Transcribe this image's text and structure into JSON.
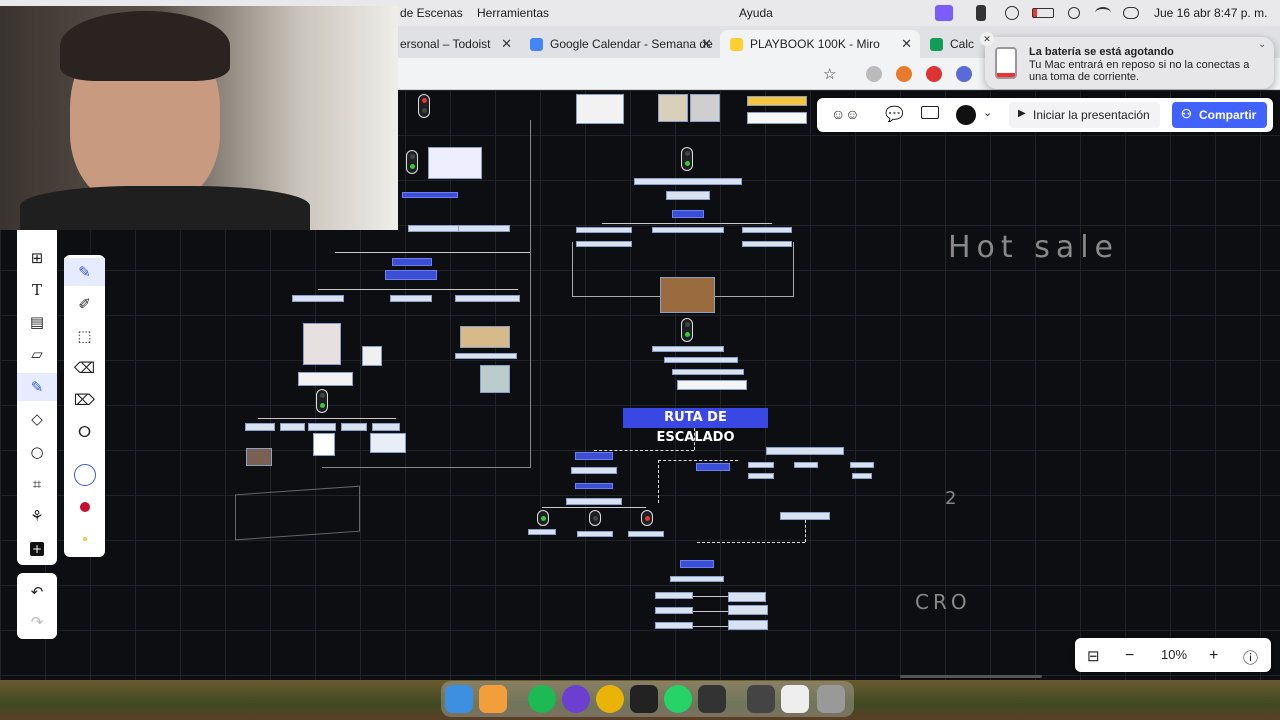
{
  "menubar": {
    "items": [
      "de Escenas",
      "Herramientas",
      "Ayuda"
    ],
    "datetime": "Jue 16 abr  8:47 p. m."
  },
  "tabs": [
    {
      "label": "ersonal – Todoist",
      "favicon_color": "#e44332"
    },
    {
      "label": "Google Calendar - Semana de",
      "favicon_color": "#4285f4"
    },
    {
      "label": "PLAYBOOK 100K - Miro",
      "favicon_color": "#ffd02f",
      "active": true
    },
    {
      "label": "Calc",
      "favicon_color": "#0f9d58"
    }
  ],
  "notification": {
    "title": "La batería se está agotando",
    "body": "Tu Mac entrará en reposo si no la conectas a una toma de corriente."
  },
  "miro_toolbar": {
    "present_label": "Iniciar la presentación",
    "share_label": "Compartir",
    "icons": [
      "reactions-icon",
      "comment-icon",
      "video-icon",
      "color-icon"
    ]
  },
  "board": {
    "banner": "RUTA DE ESCALADO",
    "handwriting": [
      "Hot sale",
      "2",
      "CRO"
    ]
  },
  "left_toolbar": {
    "tools": [
      "templates-icon",
      "text-icon",
      "frame-icon",
      "sticky-note-icon",
      "pen-icon",
      "shapes-icon",
      "comment-icon",
      "crop-icon",
      "more-tools-icon",
      "plus-icon"
    ],
    "undo": [
      "undo-icon",
      "redo-icon"
    ]
  },
  "pen_toolbar": {
    "tools": [
      "pen-icon",
      "highlighter-icon",
      "smart-draw-icon",
      "eraser-icon",
      "object-eraser-icon",
      "lasso-icon"
    ],
    "colors": [
      "#3a5bd9",
      "#c8102e",
      "#f5c542"
    ]
  },
  "zoom": {
    "level": "10%"
  },
  "colors": {
    "accent": "#4262ff",
    "banner": "#3a48e3"
  }
}
